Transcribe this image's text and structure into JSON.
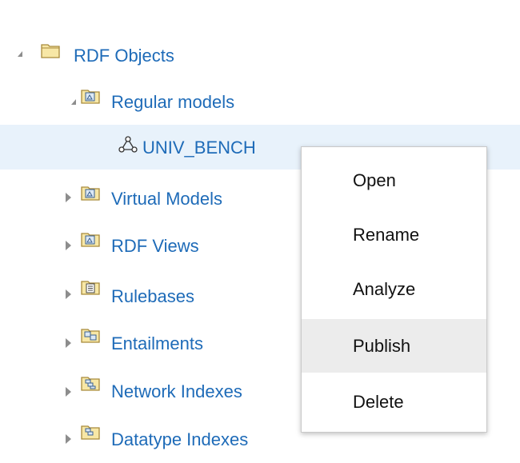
{
  "tree": {
    "items": [
      {
        "label": "RDF Objects",
        "icon": "folder-icon"
      },
      {
        "label": "Regular models",
        "icon": "model-folder-icon"
      },
      {
        "label": "UNIV_BENCH",
        "icon": "graph-model-icon"
      },
      {
        "label": "Virtual Models",
        "icon": "model-folder-icon"
      },
      {
        "label": "RDF Views",
        "icon": "model-folder-icon"
      },
      {
        "label": "Rulebases",
        "icon": "rulebase-folder-icon"
      },
      {
        "label": "Entailments",
        "icon": "entailment-folder-icon"
      },
      {
        "label": "Network Indexes",
        "icon": "index-folder-icon"
      },
      {
        "label": "Datatype Indexes",
        "icon": "index-folder-icon"
      }
    ]
  },
  "context_menu": {
    "items": [
      {
        "label": "Open"
      },
      {
        "label": "Rename"
      },
      {
        "label": "Analyze"
      },
      {
        "label": "Publish"
      },
      {
        "label": "Delete"
      }
    ]
  },
  "colors": {
    "link": "#1e6bb8",
    "selected_row": "#e8f2fb",
    "menu_hover": "#ececec"
  }
}
